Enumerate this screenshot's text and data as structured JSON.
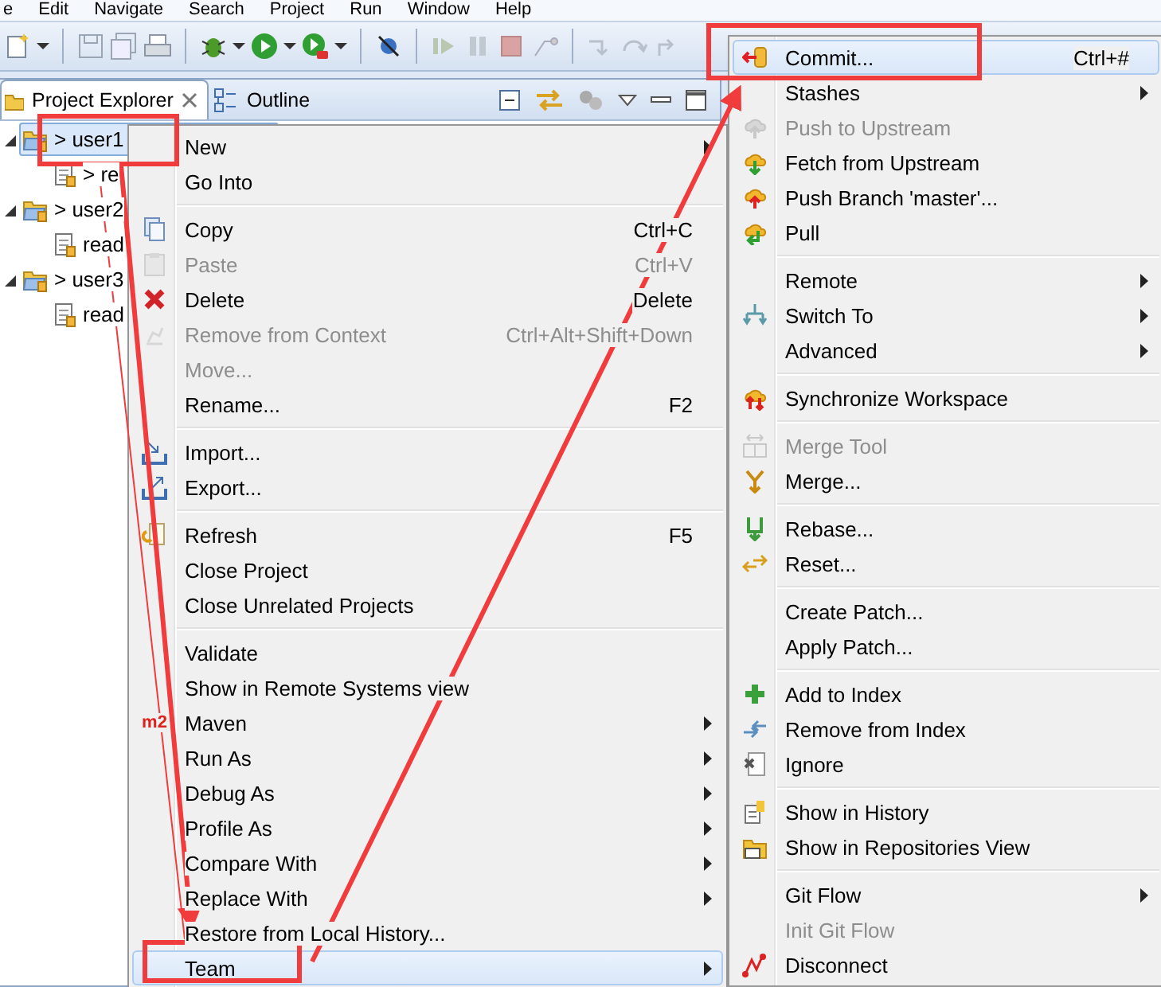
{
  "menu_bar": [
    "e",
    "Edit",
    "Navigate",
    "Search",
    "Project",
    "Run",
    "Window",
    "Help"
  ],
  "view_tabs": [
    {
      "label": "Project Explorer",
      "selected": true,
      "closable": true
    },
    {
      "label": "Outline",
      "selected": false,
      "closable": false
    }
  ],
  "tree": [
    {
      "label": "> user1",
      "selected": true,
      "expanded": true,
      "children": [
        {
          "label": "> re",
          "selected": false
        }
      ]
    },
    {
      "label": "> user2",
      "selected": false,
      "expanded": true,
      "children": [
        {
          "label": "read",
          "selected": false
        }
      ]
    },
    {
      "label": "> user3",
      "selected": false,
      "expanded": true,
      "children": [
        {
          "label": "read",
          "selected": false
        }
      ]
    }
  ],
  "context_menu": {
    "items": [
      {
        "kind": "item",
        "label": "New",
        "submenu": true,
        "disabled": false,
        "selected": false
      },
      {
        "kind": "item",
        "label": "Go Into",
        "submenu": false,
        "disabled": false,
        "selected": false
      },
      {
        "kind": "separator"
      },
      {
        "kind": "item",
        "label": "Copy",
        "shortcut": "Ctrl+C",
        "submenu": false,
        "disabled": false,
        "selected": false
      },
      {
        "kind": "item",
        "label": "Paste",
        "shortcut": "Ctrl+V",
        "submenu": false,
        "disabled": true,
        "selected": false
      },
      {
        "kind": "item",
        "label": "Delete",
        "shortcut": "Delete",
        "submenu": false,
        "disabled": false,
        "selected": false
      },
      {
        "kind": "item",
        "label": "Remove from Context",
        "shortcut": "Ctrl+Alt+Shift+Down",
        "submenu": false,
        "disabled": true,
        "selected": false
      },
      {
        "kind": "item",
        "label": "Move...",
        "submenu": false,
        "disabled": true,
        "selected": false
      },
      {
        "kind": "item",
        "label": "Rename...",
        "shortcut": "F2",
        "submenu": false,
        "disabled": false,
        "selected": false
      },
      {
        "kind": "separator"
      },
      {
        "kind": "item",
        "label": "Import...",
        "submenu": false,
        "disabled": false,
        "selected": false
      },
      {
        "kind": "item",
        "label": "Export...",
        "submenu": false,
        "disabled": false,
        "selected": false
      },
      {
        "kind": "separator"
      },
      {
        "kind": "item",
        "label": "Refresh",
        "shortcut": "F5",
        "submenu": false,
        "disabled": false,
        "selected": false
      },
      {
        "kind": "item",
        "label": "Close Project",
        "submenu": false,
        "disabled": false,
        "selected": false
      },
      {
        "kind": "item",
        "label": "Close Unrelated Projects",
        "submenu": false,
        "disabled": false,
        "selected": false
      },
      {
        "kind": "separator"
      },
      {
        "kind": "item",
        "label": "Validate",
        "submenu": false,
        "disabled": false,
        "selected": false
      },
      {
        "kind": "item",
        "label": "Show in Remote Systems view",
        "submenu": false,
        "disabled": false,
        "selected": false
      },
      {
        "kind": "item",
        "label": "Maven",
        "badge": "m2",
        "submenu": true,
        "disabled": false,
        "selected": false
      },
      {
        "kind": "item",
        "label": "Run As",
        "submenu": true,
        "disabled": false,
        "selected": false
      },
      {
        "kind": "item",
        "label": "Debug As",
        "submenu": true,
        "disabled": false,
        "selected": false
      },
      {
        "kind": "item",
        "label": "Profile As",
        "submenu": true,
        "disabled": false,
        "selected": false
      },
      {
        "kind": "item",
        "label": "Compare With",
        "submenu": true,
        "disabled": false,
        "selected": false
      },
      {
        "kind": "item",
        "label": "Replace With",
        "submenu": true,
        "disabled": false,
        "selected": false
      },
      {
        "kind": "item",
        "label": "Restore from Local History...",
        "submenu": false,
        "disabled": false,
        "selected": false
      },
      {
        "kind": "item",
        "label": "Team",
        "submenu": true,
        "disabled": false,
        "selected": true
      }
    ]
  },
  "team_submenu": {
    "items": [
      {
        "kind": "item",
        "label": "Commit...",
        "shortcut": "Ctrl+#",
        "submenu": false,
        "disabled": false,
        "selected": true
      },
      {
        "kind": "item",
        "label": "Stashes",
        "submenu": true,
        "disabled": false,
        "selected": false
      },
      {
        "kind": "item",
        "label": "Push to Upstream",
        "submenu": false,
        "disabled": true,
        "selected": false
      },
      {
        "kind": "item",
        "label": "Fetch from Upstream",
        "submenu": false,
        "disabled": false,
        "selected": false
      },
      {
        "kind": "item",
        "label": "Push Branch 'master'...",
        "submenu": false,
        "disabled": false,
        "selected": false
      },
      {
        "kind": "item",
        "label": "Pull",
        "submenu": false,
        "disabled": false,
        "selected": false
      },
      {
        "kind": "separator"
      },
      {
        "kind": "item",
        "label": "Remote",
        "submenu": true,
        "disabled": false,
        "selected": false
      },
      {
        "kind": "item",
        "label": "Switch To",
        "submenu": true,
        "disabled": false,
        "selected": false
      },
      {
        "kind": "item",
        "label": "Advanced",
        "submenu": true,
        "disabled": false,
        "selected": false
      },
      {
        "kind": "separator"
      },
      {
        "kind": "item",
        "label": "Synchronize Workspace",
        "submenu": false,
        "disabled": false,
        "selected": false
      },
      {
        "kind": "separator"
      },
      {
        "kind": "item",
        "label": "Merge Tool",
        "submenu": false,
        "disabled": true,
        "selected": false
      },
      {
        "kind": "item",
        "label": "Merge...",
        "submenu": false,
        "disabled": false,
        "selected": false
      },
      {
        "kind": "separator"
      },
      {
        "kind": "item",
        "label": "Rebase...",
        "submenu": false,
        "disabled": false,
        "selected": false
      },
      {
        "kind": "item",
        "label": "Reset...",
        "submenu": false,
        "disabled": false,
        "selected": false
      },
      {
        "kind": "separator"
      },
      {
        "kind": "item",
        "label": "Create Patch...",
        "submenu": false,
        "disabled": false,
        "selected": false
      },
      {
        "kind": "item",
        "label": "Apply Patch...",
        "submenu": false,
        "disabled": false,
        "selected": false
      },
      {
        "kind": "separator"
      },
      {
        "kind": "item",
        "label": "Add to Index",
        "submenu": false,
        "disabled": false,
        "selected": false
      },
      {
        "kind": "item",
        "label": "Remove from Index",
        "submenu": false,
        "disabled": false,
        "selected": false
      },
      {
        "kind": "item",
        "label": "Ignore",
        "submenu": false,
        "disabled": false,
        "selected": false
      },
      {
        "kind": "separator"
      },
      {
        "kind": "item",
        "label": "Show in History",
        "submenu": false,
        "disabled": false,
        "selected": false
      },
      {
        "kind": "item",
        "label": "Show in Repositories View",
        "submenu": false,
        "disabled": false,
        "selected": false
      },
      {
        "kind": "separator"
      },
      {
        "kind": "item",
        "label": "Git Flow",
        "submenu": true,
        "disabled": false,
        "selected": false
      },
      {
        "kind": "item",
        "label": "Init Git Flow",
        "submenu": false,
        "disabled": true,
        "selected": false
      },
      {
        "kind": "item",
        "label": "Disconnect",
        "submenu": false,
        "disabled": false,
        "selected": false
      }
    ]
  }
}
